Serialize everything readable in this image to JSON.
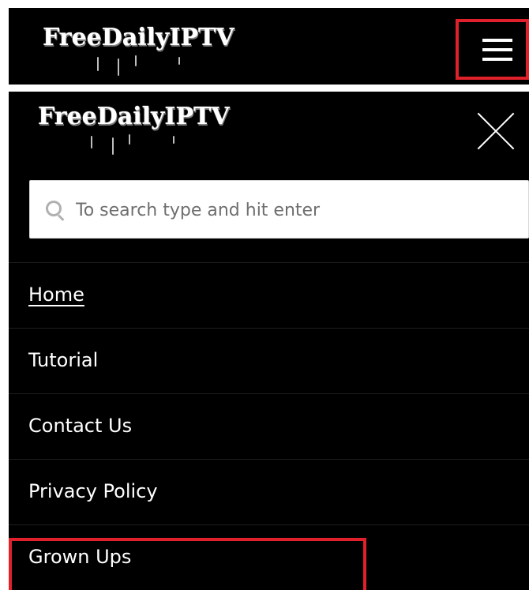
{
  "site": {
    "logo_text": "FreeDailyIPTV"
  },
  "header": {
    "menu_button_icon": "hamburger-icon"
  },
  "drawer": {
    "close_icon": "close-icon",
    "search": {
      "placeholder": "To search type and hit enter",
      "icon": "search-icon"
    },
    "menu_items": [
      {
        "label": "Home",
        "active": true
      },
      {
        "label": "Tutorial"
      },
      {
        "label": "Contact Us"
      },
      {
        "label": "Privacy Policy"
      },
      {
        "label": "Grown Ups"
      }
    ]
  },
  "colors": {
    "background": "#000000",
    "text": "#ffffff",
    "highlight": "#e0202a",
    "search_bg": "#ffffff"
  }
}
